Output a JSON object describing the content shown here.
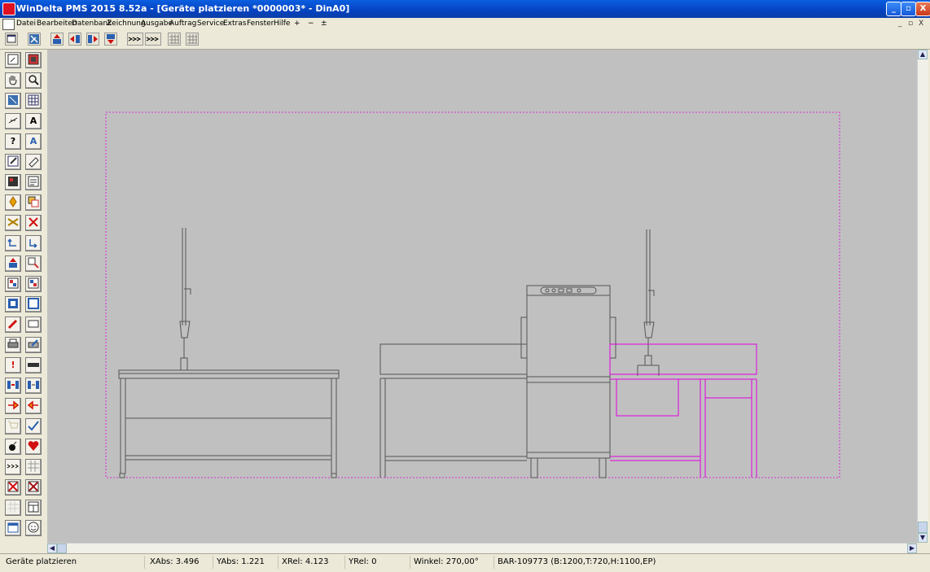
{
  "window": {
    "title": "WinDelta PMS 2015 8.52a - [Geräte platzieren *0000003* - DinA0]",
    "controls": {
      "minimize": "_",
      "maximize": "▫",
      "close": "X"
    }
  },
  "menu": {
    "items": [
      "Datei",
      "Bearbeiten",
      "Datenbank",
      "Zeichnung",
      "Ausgabe",
      "Auftrag",
      "Service",
      "Extras",
      "Fenster",
      "Hilfe",
      "+",
      "−",
      "±"
    ],
    "mdi_controls": [
      "_",
      "▫",
      "X"
    ]
  },
  "sidebar_glyphs": {
    "text_tool": "A",
    "help": "?",
    "text_tool2": "A",
    "warning": "!"
  },
  "status": {
    "mode": "Geräte platzieren",
    "xabs": "XAbs: 3.496",
    "yabs": "YAbs: 1.221",
    "xrel": "XRel: 4.123",
    "yrel": "YRel: 0",
    "winkel": "Winkel: 270,00°",
    "item": "BAR-109773 (B:1200,T:720,H:1100,EP)"
  },
  "colors": {
    "canvas": "#c0c0c0",
    "drawing": "#555555",
    "selected": "#e000e0",
    "titlebar": "#0542c0"
  }
}
